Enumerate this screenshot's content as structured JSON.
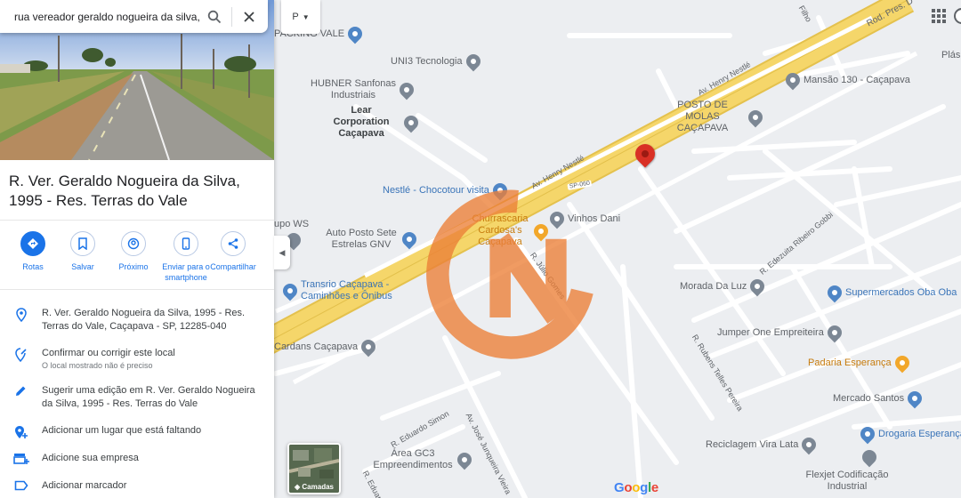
{
  "search": {
    "value": "rua vereador geraldo nogueira da silva,",
    "search_icon": "search-icon",
    "close_icon": "close-icon"
  },
  "place": {
    "title": "R. Ver. Geraldo Nogueira da Silva, 1995 - Res. Terras do Vale"
  },
  "actions": [
    {
      "label": "Rotas",
      "icon": "directions-icon"
    },
    {
      "label": "Salvar",
      "icon": "bookmark-icon"
    },
    {
      "label": "Próximo",
      "icon": "nearby-icon"
    },
    {
      "label": "Enviar para o smartphone",
      "icon": "phone-icon"
    },
    {
      "label": "Compartilhar",
      "icon": "share-icon"
    }
  ],
  "info": {
    "address": "R. Ver. Geraldo Nogueira da Silva, 1995 - Res. Terras do Vale, Caçapava - SP, 12285-040",
    "confirm": "Confirmar ou corrigir este local",
    "confirm_sub": "O local mostrado não é preciso",
    "suggest": "Sugerir uma edição em R. Ver. Geraldo Nogueira da Silva, 1995 - Res. Terras do Vale",
    "add_place": "Adicionar um lugar que está faltando",
    "add_business": "Adicione sua empresa",
    "add_label": "Adicionar marcador"
  },
  "map": {
    "layer_filter": "P",
    "layers_label": "Camadas",
    "google": [
      "G",
      "o",
      "o",
      "g",
      "l",
      "e"
    ],
    "places": {
      "packing": "PACKING VALE",
      "uni3": "UNI3 Tecnologia",
      "hubner": "HUBNER Sanfonas Industriais",
      "lear": "Lear Corporation Caçapava",
      "mansao": "Mansão 130 - Caçapava",
      "posto_molas": "POSTO DE MOLAS CAÇAPAVA",
      "nestle": "Nestlé - Chocotour visita",
      "churrascaria": "Churrascaria Cardosa's Caçapava",
      "vinhos": "Vinhos Dani",
      "grupo_ws": "upo WS",
      "auto_posto": "Auto Posto Sete Estrelas GNV",
      "transrio": "Transrio Caçapava - Caminhões e Ônibus",
      "morada": "Morada Da Luz",
      "supermercados": "Supermercados Oba Oba",
      "jumper": "Jumper One Empreiteira",
      "padaria": "Padaria Esperança",
      "cardans": "Cardans Caçapava",
      "mercado": "Mercado Santos",
      "drogaria": "Drogaria Esperança",
      "area_gc3": "Área GC3 Empreendimentos",
      "reciclagem": "Reciclagem Vira Lata",
      "flexjet": "Flexjet Codificação Industrial",
      "plas": "Plás"
    },
    "streets": {
      "rod_pres": "Rod. Pres. D",
      "henry1": "Av. Henry Nestlé",
      "henry2": "Av. Henry Nestlé",
      "sp060": "SP-060",
      "julio": "R. Júlio Gomes",
      "edezuita": "R. Edezuita Ribeiro Gobbi",
      "rubens": "R. Rubens Telles Pereira",
      "eduardo": "R. Eduardo Simon",
      "jose": "Av. José Junqueira Vieira",
      "eduard2": "R. Eduard",
      "filho": "Filho"
    }
  },
  "colors": {
    "accent": "#1a73e8",
    "highway": "#f5d66a",
    "watermark": "#ec7f37"
  }
}
